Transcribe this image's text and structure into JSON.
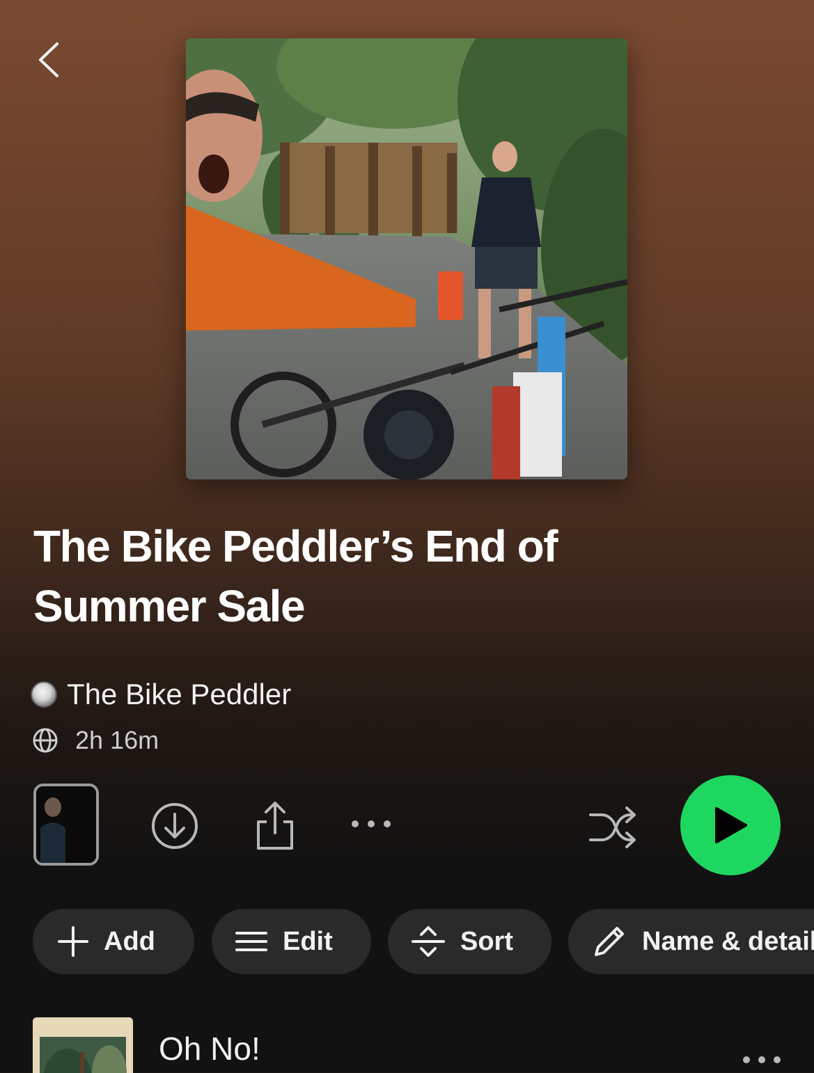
{
  "header": {
    "back_icon": "chevron-left-icon"
  },
  "playlist": {
    "title": "The Bike Peddler’s End of Summer Sale",
    "owner": "The Bike Peddler",
    "duration": "2h 16m"
  },
  "controls": {
    "icons": [
      "download-icon",
      "share-icon",
      "more-icon",
      "shuffle-icon",
      "play-icon"
    ],
    "accent_color": "#1ed760"
  },
  "chips": {
    "add": "Add",
    "edit": "Edit",
    "sort": "Sort",
    "name_details": "Name & details"
  },
  "tracks": [
    {
      "title": "Oh No!"
    }
  ]
}
